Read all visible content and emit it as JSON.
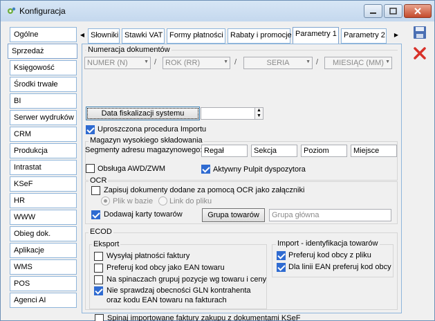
{
  "window": {
    "title": "Konfiguracja",
    "controls": {
      "minimize": "–",
      "maximize": "□",
      "close": "✕"
    }
  },
  "sidebar": {
    "items": [
      {
        "label": "Ogólne"
      },
      {
        "label": "Sprzedaż"
      },
      {
        "label": "Księgowość"
      },
      {
        "label": "Środki trwałe"
      },
      {
        "label": "BI"
      },
      {
        "label": "Serwer wydruków"
      },
      {
        "label": "CRM"
      },
      {
        "label": "Produkcja"
      },
      {
        "label": "Intrastat"
      },
      {
        "label": "KSeF"
      },
      {
        "label": "HR"
      },
      {
        "label": "WWW"
      },
      {
        "label": "Obieg dok."
      },
      {
        "label": "Aplikacje"
      },
      {
        "label": "WMS"
      },
      {
        "label": "POS"
      },
      {
        "label": "Agenci AI"
      }
    ],
    "active_index": 1
  },
  "tabs": {
    "prev_arrow": "◀",
    "next_arrow": "▶",
    "items": [
      {
        "label": "Słowniki"
      },
      {
        "label": "Stawki VAT"
      },
      {
        "label": "Formy płatności"
      },
      {
        "label": "Rabaty i promocje"
      },
      {
        "label": "Parametry 1"
      },
      {
        "label": "Parametry 2"
      }
    ],
    "active_index": 4
  },
  "numeracja": {
    "title": "Numeracja dokumentów",
    "fields": [
      "NUMER (N)",
      "ROK (RR)",
      "SERIA",
      "MIESIĄC (MM)"
    ],
    "separator": "/"
  },
  "data_fiskalizacji": {
    "button_label": "Data fiskalizacji systemu",
    "value": ""
  },
  "uproszczona": {
    "label": "Uproszczona procedura Importu",
    "checked": true
  },
  "magazyn": {
    "title": "Magazyn wysokiego składowania",
    "segments_label": "Segmenty adresu magazynowego:",
    "segments": [
      "Regał",
      "Sekcja",
      "Poziom",
      "Miejsce"
    ],
    "awd": {
      "label": "Obsługa AWD/ZWM",
      "checked": false
    },
    "pulpit": {
      "label": "Aktywny Pulpit dyspozytora",
      "checked": true
    }
  },
  "ocr": {
    "title": "OCR",
    "zapisuj": {
      "label": "Zapisuj dokumenty dodane za pomocą OCR jako załączniki",
      "checked": false
    },
    "radio_plik": "Plik w bazie",
    "radio_link": "Link do pliku",
    "dodawaj": {
      "label": "Dodawaj karty towarów",
      "checked": true
    },
    "grupa_button": "Grupa towarów",
    "grupa_value": "Grupa główna"
  },
  "ecod": {
    "title": "ECOD",
    "eksport": {
      "title": "Eksport",
      "items": [
        {
          "label": "Wysyłaj płatności faktury",
          "checked": false
        },
        {
          "label": "Preferuj kod obcy jako EAN towaru",
          "checked": false
        },
        {
          "label": "Na spinaczach grupuj pozycje wg towaru i ceny",
          "checked": false
        },
        {
          "label": "Nie sprawdzaj obecności GLN kontrahenta",
          "label2": "oraz kodu EAN towaru na fakturach",
          "checked": true
        }
      ]
    },
    "import": {
      "title": "Import - identyfikacja towarów",
      "items": [
        {
          "label": "Preferuj kod obcy z pliku",
          "checked": true
        },
        {
          "label": "Dla linii EAN preferuj kod obcy",
          "checked": true
        }
      ]
    },
    "spinaj": {
      "label": "Spinaj importowane faktury zakupu z dokumentami KSeF",
      "checked": false
    }
  },
  "toolbar": {
    "save": "save-icon",
    "cancel": "cancel-icon"
  },
  "colors": {
    "accent": "#2f6bd1",
    "tab_border": "#8eb5db",
    "close_red": "#d8322a"
  }
}
